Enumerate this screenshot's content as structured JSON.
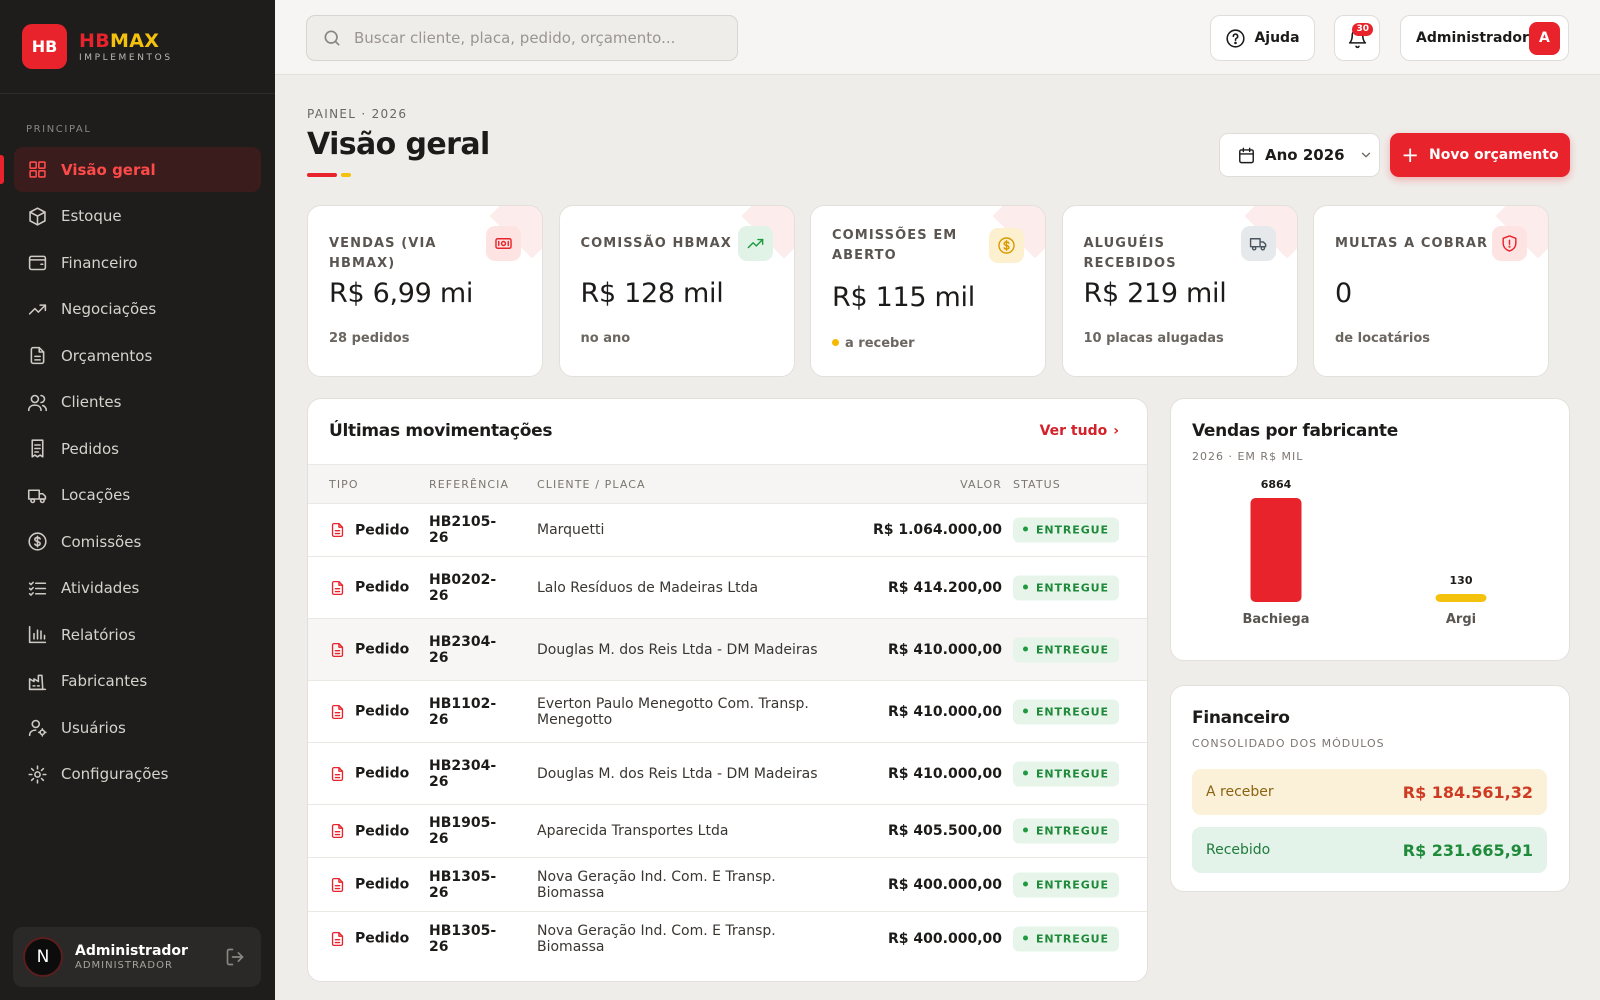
{
  "brand": {
    "logo": "HB",
    "name_part1": "HB",
    "name_part2": "MAX",
    "subtitle": "IMPLEMENTOS"
  },
  "sidebar": {
    "section": "PRINCIPAL",
    "items": [
      {
        "label": "Visão geral",
        "icon": "grid-icon"
      },
      {
        "label": "Estoque",
        "icon": "box-icon"
      },
      {
        "label": "Financeiro",
        "icon": "wallet-icon"
      },
      {
        "label": "Negociações",
        "icon": "trend-up-icon"
      },
      {
        "label": "Orçamentos",
        "icon": "document-icon"
      },
      {
        "label": "Clientes",
        "icon": "users-icon"
      },
      {
        "label": "Pedidos",
        "icon": "receipt-icon"
      },
      {
        "label": "Locações",
        "icon": "truck-icon"
      },
      {
        "label": "Comissões",
        "icon": "dollar-circle-icon"
      },
      {
        "label": "Atividades",
        "icon": "checklist-icon"
      },
      {
        "label": "Relatórios",
        "icon": "bar-chart-icon"
      },
      {
        "label": "Fabricantes",
        "icon": "factory-icon"
      },
      {
        "label": "Usuários",
        "icon": "user-gear-icon"
      },
      {
        "label": "Configurações",
        "icon": "gear-icon"
      }
    ],
    "active_index": 0,
    "user": {
      "initial": "N",
      "name": "Administrador",
      "role": "ADMINISTRADOR"
    }
  },
  "topbar": {
    "search_placeholder": "Buscar cliente, placa, pedido, orçamento...",
    "help_label": "Ajuda",
    "notifications_count": "30",
    "user_name": "Administrador",
    "user_initial": "A"
  },
  "page": {
    "breadcrumb": "PAINEL · 2026",
    "title": "Visão geral",
    "year_select": "Ano 2026",
    "new_button": "Novo orçamento"
  },
  "stats": [
    {
      "label": "VENDAS (VIA HBMAX)",
      "value": "R$ 6,99 mi",
      "sub": "28 pedidos",
      "icon": "cash-icon",
      "color": "#e8232b"
    },
    {
      "label": "COMISSÃO HBMAX",
      "value": "R$ 128 mil",
      "sub": "no ano",
      "icon": "trend-up-icon",
      "color": "#1f9a40"
    },
    {
      "label": "COMISSÕES EM ABERTO",
      "value": "R$ 115 mil",
      "sub": "a receber",
      "icon": "dollar-circle-icon",
      "color": "#d99a00"
    },
    {
      "label": "ALUGUÉIS RECEBIDOS",
      "value": "R$ 219 mil",
      "sub": "10 placas alugadas",
      "icon": "truck-icon",
      "color": "#4a5560"
    },
    {
      "label": "MULTAS A COBRAR",
      "value": "0",
      "sub": "de locatários",
      "icon": "shield-alert-icon",
      "color": "#e8232b"
    }
  ],
  "movements": {
    "title": "Últimas movimentações",
    "link": "Ver tudo",
    "columns": [
      "TIPO",
      "REFERÊNCIA",
      "CLIENTE / PLACA",
      "VALOR",
      "STATUS"
    ],
    "rows": [
      {
        "tipo": "Pedido",
        "ref": "HB2105-26",
        "cliente": "Marquetti",
        "valor": "R$ 1.064.000,00",
        "status": "ENTREGUE"
      },
      {
        "tipo": "Pedido",
        "ref": "HB0202-26",
        "cliente": "Lalo Resíduos de Madeiras Ltda",
        "valor": "R$ 414.200,00",
        "status": "ENTREGUE"
      },
      {
        "tipo": "Pedido",
        "ref": "HB2304-26",
        "cliente": "Douglas M. dos Reis Ltda - DM Madeiras",
        "valor": "R$ 410.000,00",
        "status": "ENTREGUE"
      },
      {
        "tipo": "Pedido",
        "ref": "HB1102-26",
        "cliente": "Everton Paulo Menegotto Com. Transp. Menegotto",
        "valor": "R$ 410.000,00",
        "status": "ENTREGUE"
      },
      {
        "tipo": "Pedido",
        "ref": "HB2304-26",
        "cliente": "Douglas M. dos Reis Ltda - DM Madeiras",
        "valor": "R$ 410.000,00",
        "status": "ENTREGUE"
      },
      {
        "tipo": "Pedido",
        "ref": "HB1905-26",
        "cliente": "Aparecida Transportes Ltda",
        "valor": "R$ 405.500,00",
        "status": "ENTREGUE"
      },
      {
        "tipo": "Pedido",
        "ref": "HB1305-26",
        "cliente": "Nova Geração Ind. Com. E Transp. Biomassa",
        "valor": "R$ 400.000,00",
        "status": "ENTREGUE"
      },
      {
        "tipo": "Pedido",
        "ref": "HB1305-26",
        "cliente": "Nova Geração Ind. Com. E Transp. Biomassa",
        "valor": "R$ 400.000,00",
        "status": "ENTREGUE"
      }
    ]
  },
  "sales_chart": {
    "title": "Vendas por fabricante",
    "subtitle": "2026 · EM R$ MIL"
  },
  "chart_data": {
    "type": "bar",
    "categories": [
      "Bachiega",
      "Argi"
    ],
    "values": [
      6864,
      130
    ],
    "title": "Vendas por fabricante",
    "subtitle": "2026 · EM R$ MIL",
    "colors": [
      "#e8232b",
      "#f4c20d"
    ],
    "grid": false
  },
  "finance": {
    "title": "Financeiro",
    "subtitle": "CONSOLIDADO DOS MÓDULOS",
    "receivable_label": "A receber",
    "receivable_value": "R$ 184.561,32",
    "received_label": "Recebido",
    "received_value": "R$ 231.665,91"
  }
}
